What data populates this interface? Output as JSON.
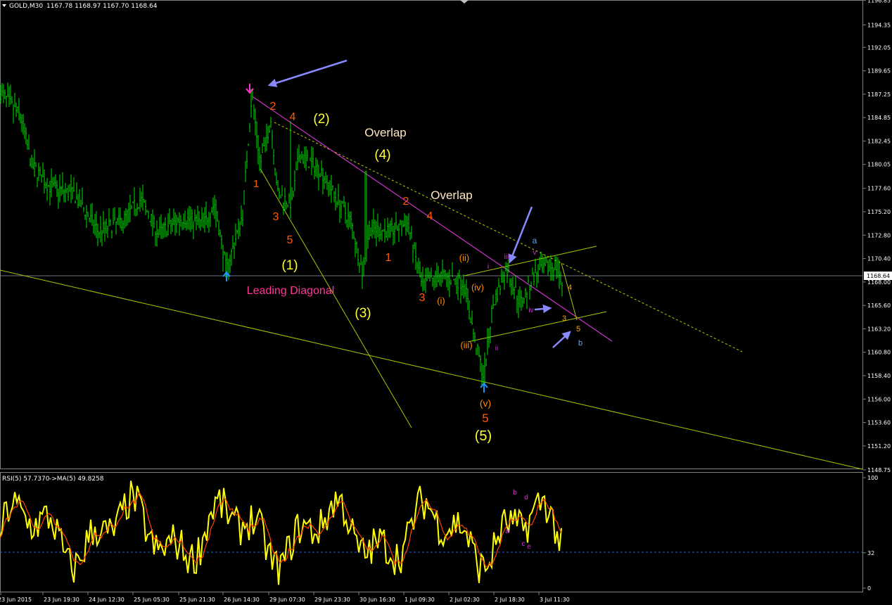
{
  "header": {
    "symbol": "GOLD,M30",
    "ohlc": "1167.78 1168.97 1167.70 1168.64",
    "rsi_label": "RSI(5) 57.7370",
    "ma_label": "->MA(5) 49.8258"
  },
  "price_axis": {
    "ticks": [
      "1196.85",
      "1194.35",
      "1192.05",
      "1189.65",
      "1187.25",
      "1184.85",
      "1182.45",
      "1180.05",
      "1177.60",
      "1175.20",
      "1172.80",
      "1170.40",
      "1168.00",
      "1165.60",
      "1163.20",
      "1160.80",
      "1158.40",
      "1156.00",
      "1153.60",
      "1151.20",
      "1148.75"
    ],
    "current": "1168.64"
  },
  "rsi_axis": {
    "ticks": [
      "100",
      "32",
      "0"
    ]
  },
  "time_axis": {
    "labels": [
      "23 Jun 2015",
      "23 Jun 19:30",
      "24 Jun 12:30",
      "25 Jun 05:30",
      "25 Jun 21:30",
      "26 Jun 14:30",
      "29 Jun 07:30",
      "29 Jun 23:30",
      "30 Jun 16:30",
      "1 Jul 09:30",
      "2 Jul 02:30",
      "2 Jul 18:30",
      "3 Jul 11:30"
    ]
  },
  "annotations": {
    "wave_labels": [
      "2",
      "4",
      "(2)",
      "Overlap",
      "(4)",
      "1",
      "Overlap",
      "3",
      "2",
      "4",
      "5",
      "(1)",
      "1",
      "Leading Diagonal",
      "(3)",
      "3",
      "(i)",
      "(ii)",
      "(iv)",
      "(iii)",
      "i",
      "ii",
      "iii",
      "iv",
      "v",
      "a",
      "b",
      "3",
      "4",
      "5",
      "(v)",
      "5",
      "(5)"
    ],
    "rsi_labels": [
      "b",
      "d",
      "a",
      "c",
      "e"
    ]
  },
  "chart_data": [
    {
      "type": "bar",
      "title": "GOLD,M30",
      "bar_style": "OHLC",
      "x_categories": [
        "23 Jun 2015",
        "23 Jun 19:30",
        "24 Jun 12:30",
        "25 Jun 05:30",
        "25 Jun 21:30",
        "26 Jun 14:30",
        "29 Jun 07:30",
        "29 Jun 23:30",
        "30 Jun 16:30",
        "1 Jul 09:30",
        "2 Jul 02:30",
        "2 Jul 18:30",
        "3 Jul 11:30"
      ],
      "ylim": [
        1147.5,
        1197.5
      ],
      "approx_close_path": [
        [
          0,
          1187.5
        ],
        [
          30,
          1184.9
        ],
        [
          45,
          1180.0
        ],
        [
          70,
          1177.8
        ],
        [
          105,
          1177.0
        ],
        [
          140,
          1173.2
        ],
        [
          175,
          1174.3
        ],
        [
          200,
          1176.5
        ],
        [
          225,
          1173.0
        ],
        [
          260,
          1174.6
        ],
        [
          290,
          1174.0
        ],
        [
          305,
          1176.0
        ],
        [
          322,
          1169.2
        ],
        [
          345,
          1175.0
        ],
        [
          358,
          1187.3
        ],
        [
          370,
          1180.1
        ],
        [
          385,
          1184.6
        ],
        [
          395,
          1177.0
        ],
        [
          415,
          1176.0
        ],
        [
          425,
          1181.0
        ],
        [
          455,
          1179.5
        ],
        [
          500,
          1174.0
        ],
        [
          515,
          1169.0
        ],
        [
          525,
          1173.5
        ],
        [
          555,
          1173.2
        ],
        [
          580,
          1174.0
        ],
        [
          600,
          1167.5
        ],
        [
          625,
          1168.7
        ],
        [
          660,
          1167.9
        ],
        [
          675,
          1162.0
        ],
        [
          688,
          1158.2
        ],
        [
          700,
          1165.5
        ],
        [
          720,
          1169.4
        ],
        [
          740,
          1165.8
        ],
        [
          760,
          1168.8
        ],
        [
          790,
          1169.8
        ],
        [
          800,
          1167.6
        ]
      ],
      "overlays": {
        "current_price_line": 1168.64,
        "rsi_levels": [
          32
        ]
      }
    },
    {
      "type": "line",
      "title": "RSI(5) 57.7370 ->MA(5) 49.8258",
      "ylim": [
        0,
        100
      ],
      "series": [
        {
          "name": "RSI(5)",
          "color": "#ffff00"
        },
        {
          "name": "MA(5)",
          "color": "#ff4500"
        }
      ],
      "levels": [
        32
      ]
    }
  ],
  "colors": {
    "bars": "#00e000",
    "axis_text": "#ffffff",
    "rsi": "#ffff00",
    "rsi_ma": "#ff4500",
    "trend_pink": "#cc33cc",
    "trend_yellow": "#a8c800",
    "arrow_blue": "#8888ff",
    "label_orange": "#ff5a00",
    "label_yellow": "#ffff33",
    "label_pink": "#ff3399",
    "label_cream": "#ffe7c2"
  }
}
